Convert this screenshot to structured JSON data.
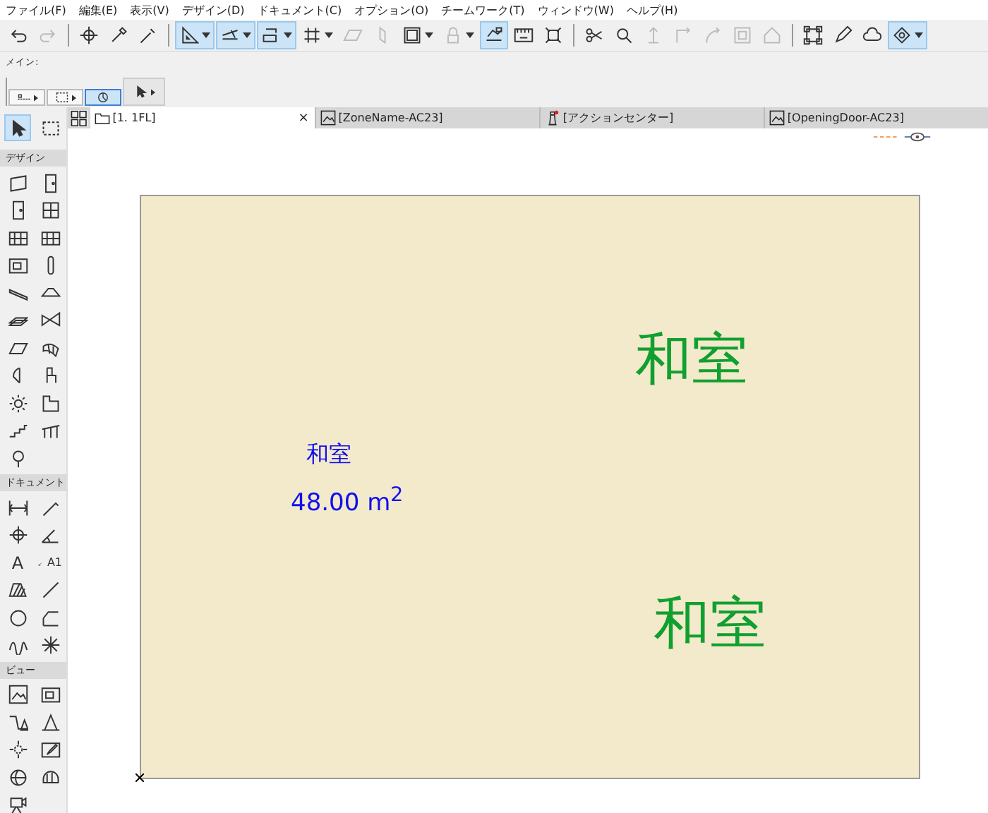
{
  "menu": [
    "ファイル(F)",
    "編集(E)",
    "表示(V)",
    "デザイン(D)",
    "ドキュメント(C)",
    "オプション(O)",
    "チームワーク(T)",
    "ウィンドウ(W)",
    "ヘルプ(H)"
  ],
  "toolbar": {
    "groups": [
      {
        "buttons": [
          {
            "selected": false,
            "disabled": false,
            "dropdown": false
          },
          {
            "selected": false,
            "disabled": true,
            "dropdown": false
          }
        ]
      },
      {
        "buttons": [
          {
            "selected": false,
            "disabled": false,
            "dropdown": false
          },
          {
            "selected": false,
            "disabled": false,
            "dropdown": false
          },
          {
            "selected": false,
            "disabled": false,
            "dropdown": false
          }
        ]
      },
      {
        "buttons": [
          {
            "selected": true,
            "disabled": false,
            "dropdown": true
          },
          {
            "selected": true,
            "disabled": false,
            "dropdown": true
          },
          {
            "selected": true,
            "disabled": false,
            "dropdown": true
          },
          {
            "selected": false,
            "disabled": false,
            "dropdown": true
          },
          {
            "selected": false,
            "disabled": true,
            "dropdown": false
          },
          {
            "selected": false,
            "disabled": true,
            "dropdown": false
          },
          {
            "selected": false,
            "disabled": false,
            "dropdown": true
          },
          {
            "selected": false,
            "disabled": true,
            "dropdown": true
          },
          {
            "selected": true,
            "disabled": false,
            "dropdown": false
          },
          {
            "selected": false,
            "disabled": false,
            "dropdown": false
          },
          {
            "selected": false,
            "disabled": false,
            "dropdown": false
          }
        ]
      },
      {
        "buttons": [
          {
            "selected": false,
            "disabled": false,
            "dropdown": false
          },
          {
            "selected": false,
            "disabled": false,
            "dropdown": false
          },
          {
            "selected": false,
            "disabled": true,
            "dropdown": false
          },
          {
            "selected": false,
            "disabled": true,
            "dropdown": false
          },
          {
            "selected": false,
            "disabled": true,
            "dropdown": false
          },
          {
            "selected": false,
            "disabled": true,
            "dropdown": false
          },
          {
            "selected": false,
            "disabled": true,
            "dropdown": false
          }
        ]
      },
      {
        "buttons": [
          {
            "selected": false,
            "disabled": false,
            "dropdown": false
          },
          {
            "selected": false,
            "disabled": false,
            "dropdown": false
          },
          {
            "selected": false,
            "disabled": false,
            "dropdown": false
          },
          {
            "selected": true,
            "disabled": false,
            "dropdown": true
          }
        ]
      }
    ]
  },
  "info_box": {
    "title": "メイン:",
    "buttons": [
      {
        "selected": false,
        "dropdown": true
      },
      {
        "selected": false,
        "dropdown": true
      },
      {
        "selected": true,
        "dropdown": false
      },
      {
        "selected": false,
        "dropdown": true
      }
    ]
  },
  "tabs": [
    {
      "label": "[1. 1FL]",
      "selected": true,
      "close": "×"
    },
    {
      "label": "[ZoneName-AC23]",
      "selected": false
    },
    {
      "label": "[アクションセンター]",
      "selected": false
    },
    {
      "label": "[OpeningDoor-AC23]",
      "selected": false
    }
  ],
  "toolbox": {
    "pointer_tools": [
      {
        "selected": true
      },
      {
        "selected": false
      }
    ],
    "sections": [
      {
        "title": "デザイン",
        "tools": [
          {
            "kind": "icon"
          },
          {
            "kind": "icon"
          },
          {
            "kind": "icon"
          },
          {
            "kind": "icon"
          },
          {
            "kind": "icon"
          },
          {
            "kind": "icon"
          },
          {
            "kind": "icon"
          },
          {
            "kind": "icon"
          },
          {
            "kind": "icon"
          },
          {
            "kind": "icon"
          },
          {
            "kind": "icon"
          },
          {
            "kind": "icon"
          },
          {
            "kind": "icon"
          },
          {
            "kind": "icon"
          },
          {
            "kind": "icon"
          },
          {
            "kind": "icon"
          },
          {
            "kind": "icon"
          },
          {
            "kind": "icon"
          },
          {
            "kind": "icon"
          },
          {
            "kind": "icon"
          },
          {
            "kind": "icon"
          }
        ]
      },
      {
        "title": "ドキュメント",
        "tools": [
          {
            "kind": "icon"
          },
          {
            "kind": "icon"
          },
          {
            "kind": "icon"
          },
          {
            "kind": "icon"
          },
          {
            "kind": "text",
            "glyph": "A"
          },
          {
            "kind": "label",
            "glyph": "A1"
          },
          {
            "kind": "icon"
          },
          {
            "kind": "icon"
          },
          {
            "kind": "icon"
          },
          {
            "kind": "icon"
          },
          {
            "kind": "icon"
          },
          {
            "kind": "icon"
          }
        ]
      },
      {
        "title": "ビュー",
        "tools": [
          {
            "kind": "icon"
          },
          {
            "kind": "icon"
          },
          {
            "kind": "icon"
          },
          {
            "kind": "icon"
          },
          {
            "kind": "icon"
          },
          {
            "kind": "icon"
          },
          {
            "kind": "icon"
          },
          {
            "kind": "icon"
          },
          {
            "kind": "icon"
          }
        ]
      }
    ]
  },
  "zone": {
    "labels": [
      {
        "kind": "stamp",
        "text": "和室"
      },
      {
        "kind": "stamp",
        "text": "48.00 m$^{2}$"
      },
      {
        "kind": "big",
        "text": "和室"
      },
      {
        "kind": "big",
        "text": "和室"
      }
    ]
  }
}
